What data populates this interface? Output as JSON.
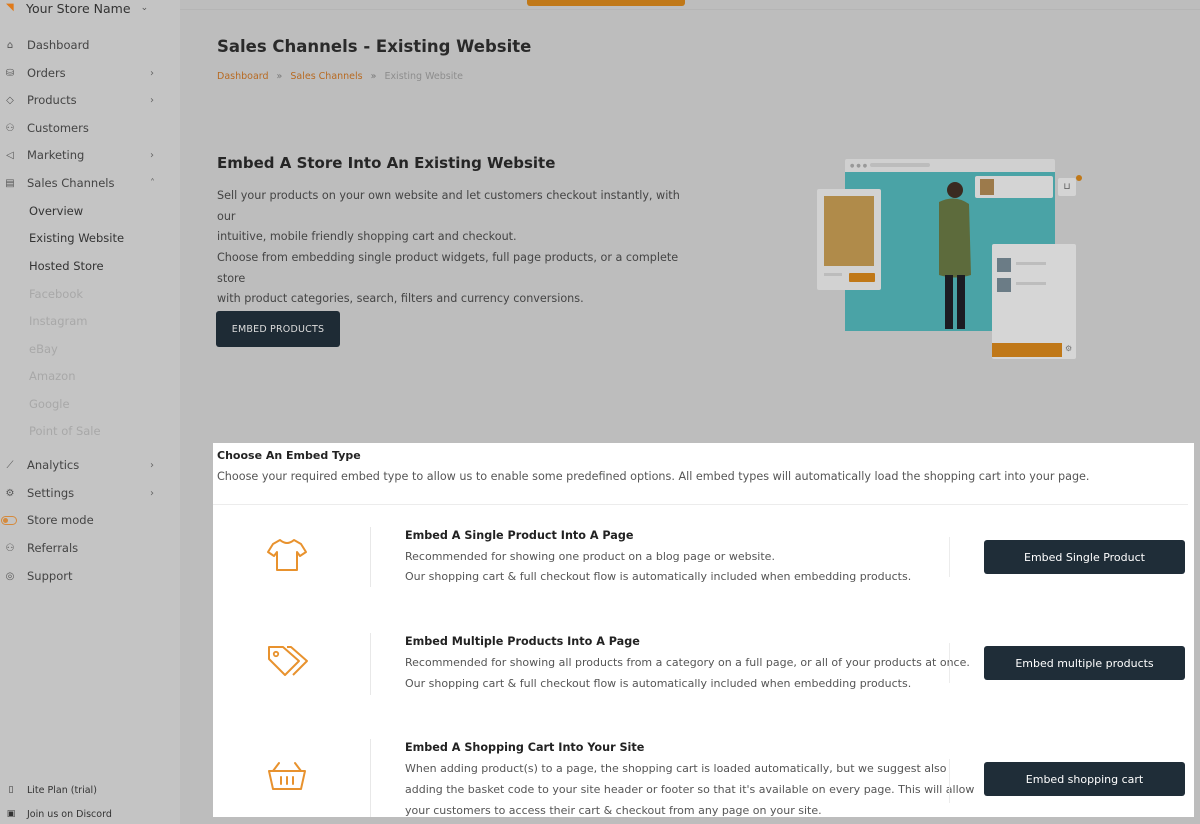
{
  "store": {
    "name": "Your Store Name"
  },
  "sidebar": {
    "items": [
      {
        "label": "Dashboard",
        "icon": "home-icon",
        "has_arrow": false
      },
      {
        "label": "Orders",
        "icon": "orders-icon",
        "has_arrow": true
      },
      {
        "label": "Products",
        "icon": "tag-icon",
        "has_arrow": true
      },
      {
        "label": "Customers",
        "icon": "users-icon",
        "has_arrow": false
      },
      {
        "label": "Marketing",
        "icon": "megaphone-icon",
        "has_arrow": true
      },
      {
        "label": "Sales Channels",
        "icon": "store-icon",
        "expanded": true
      }
    ],
    "sub_items": [
      {
        "label": "Overview",
        "enabled": true
      },
      {
        "label": "Existing Website",
        "enabled": true,
        "active": true
      },
      {
        "label": "Hosted Store",
        "enabled": true
      },
      {
        "label": "Facebook",
        "enabled": false
      },
      {
        "label": "Instagram",
        "enabled": false
      },
      {
        "label": "eBay",
        "enabled": false
      },
      {
        "label": "Amazon",
        "enabled": false
      },
      {
        "label": "Google",
        "enabled": false
      },
      {
        "label": "Point of Sale",
        "enabled": false
      }
    ],
    "items2": [
      {
        "label": "Analytics",
        "icon": "chart-icon",
        "has_arrow": true
      },
      {
        "label": "Settings",
        "icon": "gear-icon",
        "has_arrow": true
      },
      {
        "label": "Store mode",
        "icon": "toggle-icon",
        "has_arrow": false
      },
      {
        "label": "Referrals",
        "icon": "user-plus-icon",
        "has_arrow": false
      },
      {
        "label": "Support",
        "icon": "globe-icon",
        "has_arrow": false
      }
    ],
    "footer": [
      {
        "label": "Lite Plan (trial)",
        "icon": "document-icon"
      },
      {
        "label": "Join us on Discord",
        "icon": "discord-icon"
      }
    ]
  },
  "page": {
    "title": "Sales Channels - Existing Website",
    "breadcrumb": [
      "Dashboard",
      "Sales Channels",
      "Existing Website"
    ],
    "breadcrumb_sep": "»"
  },
  "hero": {
    "title": "Embed A Store Into An Existing Website",
    "p1_line1": "Sell your products on your own website and let customers checkout instantly, with our",
    "p1_line2": "intuitive, mobile friendly shopping cart and checkout.",
    "p2_line1": "Choose from embedding single product widgets, full page products, or a complete store",
    "p2_line2": "with product categories, search, filters and currency conversions.",
    "button": "EMBED PRODUCTS"
  },
  "embed": {
    "title": "Choose An Embed Type",
    "subtitle": "Choose your required embed type to allow us to enable some predefined options. All embed types will automatically load the shopping cart into your page.",
    "rows": [
      {
        "title": "Embed A Single Product Into A Page",
        "lines": [
          "Recommended for showing one product on a blog page or website.",
          "Our shopping cart & full checkout flow is automatically included when embedding products."
        ],
        "button": "Embed Single Product",
        "icon": "tshirt-icon"
      },
      {
        "title": "Embed Multiple Products Into A Page",
        "lines": [
          "Recommended for showing all products from a category on a full page, or all of your products at once.",
          "Our shopping cart & full checkout flow is automatically included when embedding products."
        ],
        "button": "Embed multiple products",
        "icon": "tags-icon"
      },
      {
        "title": "Embed A Shopping Cart Into Your Site",
        "lines": [
          "When adding product(s) to a page, the shopping cart is loaded automatically, but we suggest also",
          "adding the basket code to your site header or footer so that it's available on every page. This will allow",
          "your customers to access their cart & checkout from any page on your site."
        ],
        "button": "Embed shopping cart",
        "icon": "basket-icon"
      }
    ]
  },
  "colors": {
    "accent": "#e8922e",
    "dark_button": "#1f2d38",
    "overlay": "#bdbdbd"
  }
}
